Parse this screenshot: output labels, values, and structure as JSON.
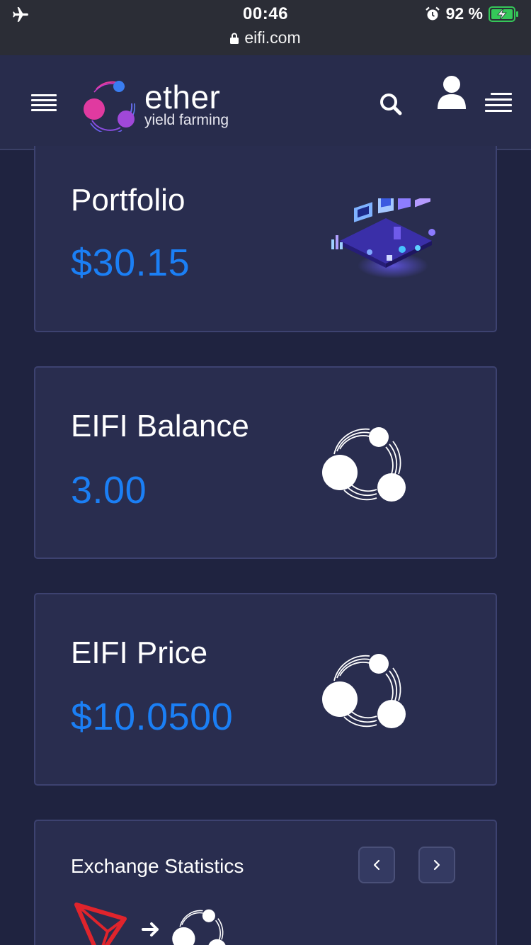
{
  "status_bar": {
    "time": "00:46",
    "url": "eifi.com",
    "battery_percent": "92 %"
  },
  "header": {
    "brand_word": "ether",
    "brand_tagline": "yield farming"
  },
  "cards": {
    "portfolio": {
      "title": "Portfolio",
      "value": "$30.15"
    },
    "balance": {
      "title": "EIFI Balance",
      "value": "3.00"
    },
    "price": {
      "title": "EIFI Price",
      "value": "$10.0500"
    }
  },
  "exchange": {
    "title": "Exchange Statistics"
  },
  "colors": {
    "background": "#1f2340",
    "card": "#292d4f",
    "accent_blue": "#1b7ff5",
    "tron_red": "#e0242c",
    "battery_green": "#35c759"
  },
  "icons": [
    "airplane-icon",
    "lock-icon",
    "alarm-icon",
    "battery-charging-icon",
    "menu-icon",
    "logo-mark",
    "search-icon",
    "user-icon",
    "menu-right-icon",
    "isometric-illustration",
    "eifi-coin-icon",
    "chevron-left-icon",
    "chevron-right-icon",
    "tron-icon",
    "arrow-right-icon"
  ]
}
